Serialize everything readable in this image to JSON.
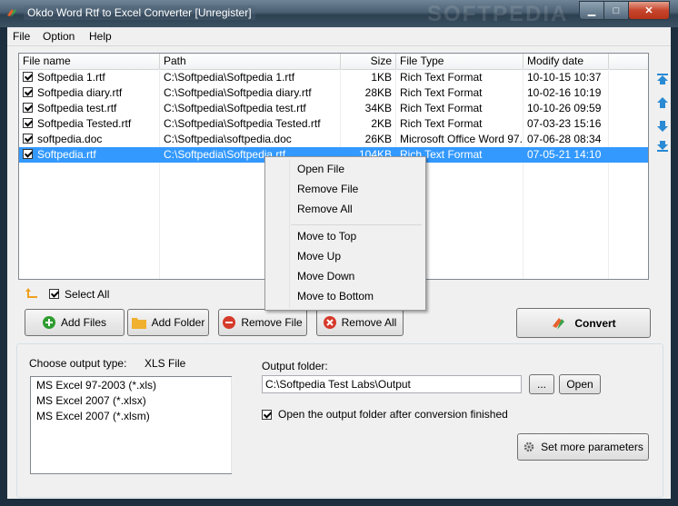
{
  "window": {
    "title": "Okdo Word Rtf to Excel Converter [Unregister]",
    "watermark": "SOFTPEDIA",
    "minimize_glyph": "▁",
    "maximize_glyph": "□",
    "close_glyph": "✕"
  },
  "menu": [
    "File",
    "Option",
    "Help"
  ],
  "columns": [
    "File name",
    "Path",
    "Size",
    "File Type",
    "Modify date"
  ],
  "files": [
    {
      "name": "Softpedia 1.rtf",
      "path": "C:\\Softpedia\\Softpedia 1.rtf",
      "size": "1KB",
      "type": "Rich Text Format",
      "date": "10-10-15 10:37",
      "checked": true,
      "selected": false
    },
    {
      "name": "Softpedia diary.rtf",
      "path": "C:\\Softpedia\\Softpedia diary.rtf",
      "size": "28KB",
      "type": "Rich Text Format",
      "date": "10-02-16 10:19",
      "checked": true,
      "selected": false
    },
    {
      "name": "Softpedia test.rtf",
      "path": "C:\\Softpedia\\Softpedia test.rtf",
      "size": "34KB",
      "type": "Rich Text Format",
      "date": "10-10-26 09:59",
      "checked": true,
      "selected": false
    },
    {
      "name": "Softpedia Tested.rtf",
      "path": "C:\\Softpedia\\Softpedia Tested.rtf",
      "size": "2KB",
      "type": "Rich Text Format",
      "date": "07-03-23 15:16",
      "checked": true,
      "selected": false
    },
    {
      "name": "softpedia.doc",
      "path": "C:\\Softpedia\\softpedia.doc",
      "size": "26KB",
      "type": "Microsoft Office Word 97...",
      "date": "07-06-28 08:34",
      "checked": true,
      "selected": false
    },
    {
      "name": "Softpedia.rtf",
      "path": "C:\\Softpedia\\Softpedia.rtf",
      "size": "104KB",
      "type": "Rich Text Format",
      "date": "07-05-21 14:10",
      "checked": true,
      "selected": true
    }
  ],
  "context_menu": {
    "group1": [
      "Open File",
      "Remove File",
      "Remove All"
    ],
    "group2": [
      "Move to Top",
      "Move Up",
      "Move Down",
      "Move to Bottom"
    ]
  },
  "select_all_label": "Select All",
  "buttons": {
    "add_files": "Add Files",
    "add_folder": "Add Folder",
    "remove_file": "Remove File",
    "remove_all": "Remove All",
    "convert": "Convert"
  },
  "output": {
    "type_label": "Choose output type:",
    "type_value": "XLS File",
    "formats": [
      "MS Excel 97-2003 (*.xls)",
      "MS Excel 2007 (*.xlsx)",
      "MS Excel 2007 (*.xlsm)"
    ],
    "folder_label": "Output folder:",
    "folder_value": "C:\\Softpedia Test Labs\\Output",
    "browse_label": "...",
    "open_label": "Open",
    "open_after_label": "Open the output folder after conversion finished",
    "more_params_label": "Set more parameters"
  },
  "colors": {
    "selection": "#3399ff",
    "arrow_blue": "#2a8ad4",
    "add_green": "#2e9c2e",
    "remove_red": "#d63a2a"
  }
}
